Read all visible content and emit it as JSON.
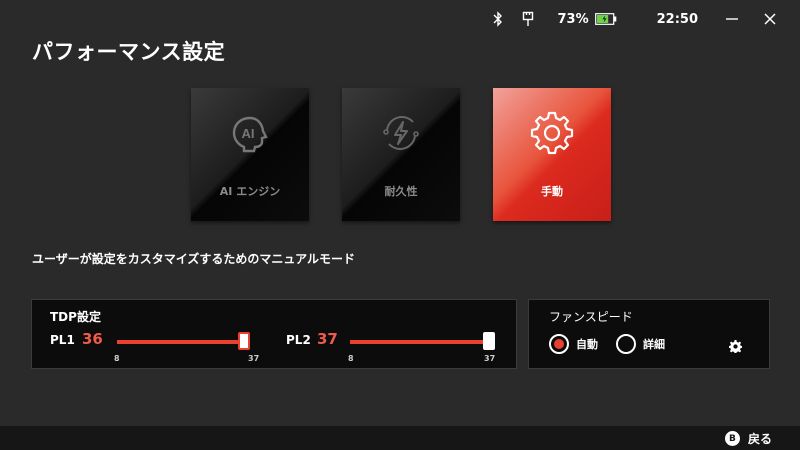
{
  "status": {
    "battery_percent": "73%",
    "battery_level": 0.73,
    "time": "22:50"
  },
  "page": {
    "title": "パフォーマンス設定",
    "description": "ユーザーが設定をカスタマイズするためのマニュアルモード"
  },
  "modes": [
    {
      "label": "AI エンジン",
      "icon": "ai-icon",
      "selected": false
    },
    {
      "label": "耐久性",
      "icon": "lightning-icon",
      "selected": false
    },
    {
      "label": "手動",
      "icon": "gear-icon",
      "selected": true
    }
  ],
  "tdp": {
    "title": "TDP設定",
    "pl1": {
      "label": "PL1",
      "value": "36",
      "min": "8",
      "max": "37"
    },
    "pl2": {
      "label": "PL2",
      "value": "37",
      "min": "8",
      "max": "37"
    }
  },
  "fan": {
    "title": "ファンスピード",
    "options": [
      {
        "label": "自動",
        "selected": true
      },
      {
        "label": "詳細",
        "selected": false
      }
    ]
  },
  "footer": {
    "back_key": "B",
    "back_label": "戻る"
  },
  "colors": {
    "accent": "#e8412f",
    "value_text": "#f05a4a",
    "background": "#2a2a2a",
    "panel": "#0c0c0c"
  }
}
